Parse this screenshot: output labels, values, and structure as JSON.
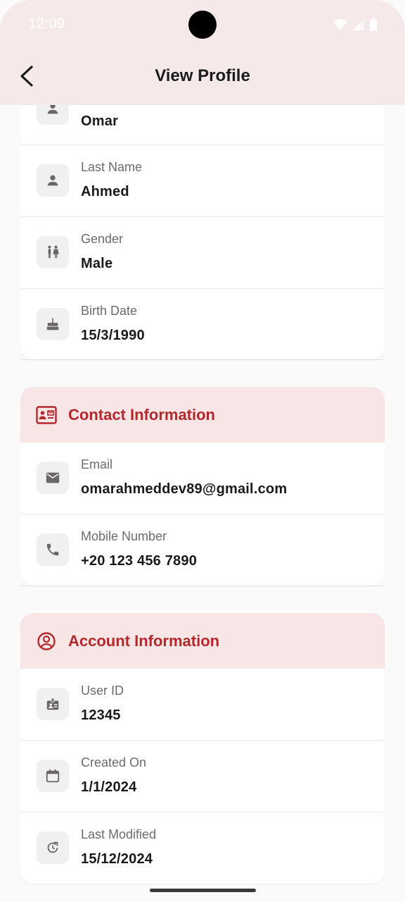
{
  "status_bar": {
    "time": "12:09"
  },
  "app_bar": {
    "title": "View Profile"
  },
  "personal_rows": [
    {
      "label": "",
      "value": "Omar",
      "icon": "person-icon"
    },
    {
      "label": "Last Name",
      "value": "Ahmed",
      "icon": "person-icon"
    },
    {
      "label": "Gender",
      "value": "Male",
      "icon": "wc-icon"
    },
    {
      "label": "Birth Date",
      "value": "15/3/1990",
      "icon": "cake-icon"
    }
  ],
  "contact": {
    "title": "Contact Information",
    "rows": [
      {
        "label": "Email",
        "value": "omarahmeddev89@gmail.com",
        "icon": "mail-icon"
      },
      {
        "label": "Mobile Number",
        "value": "+20 123 456 7890",
        "icon": "phone-icon"
      }
    ]
  },
  "account": {
    "title": "Account Information",
    "rows": [
      {
        "label": "User ID",
        "value": "12345",
        "icon": "badge-icon"
      },
      {
        "label": "Created On",
        "value": "1/1/2024",
        "icon": "calendar-icon"
      },
      {
        "label": "Last Modified",
        "value": "15/12/2024",
        "icon": "update-icon"
      }
    ]
  },
  "colors": {
    "accent": "#b3282d",
    "header_bg": "#f8e6e6",
    "appbar_bg": "#f5e9e9"
  }
}
